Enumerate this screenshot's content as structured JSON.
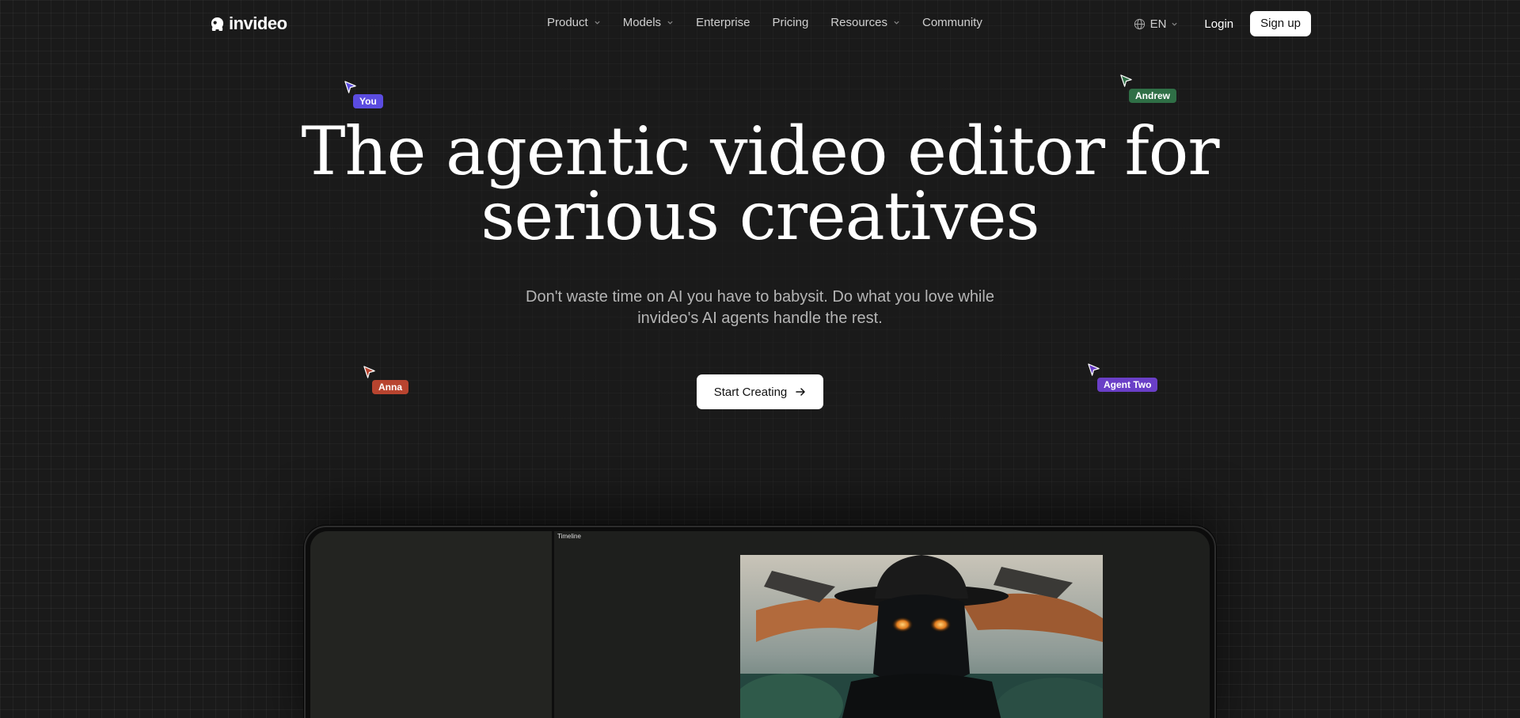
{
  "nav": {
    "logo_text": "invideo",
    "menu": [
      {
        "label": "Product",
        "dropdown": true
      },
      {
        "label": "Models",
        "dropdown": true
      },
      {
        "label": "Enterprise",
        "dropdown": false
      },
      {
        "label": "Pricing",
        "dropdown": false
      },
      {
        "label": "Resources",
        "dropdown": true
      },
      {
        "label": "Community",
        "dropdown": false
      }
    ],
    "language": "EN",
    "login": "Login",
    "signup": "Sign up"
  },
  "hero": {
    "headline_line1": "The agentic video editor for",
    "headline_line2": "serious creatives",
    "subheadline_line1": "Don't waste time on AI you have to babysit. Do what you love while",
    "subheadline_line2": "invideo's AI agents handle the rest.",
    "cta_label": "Start Creating"
  },
  "cursors": [
    {
      "name": "You",
      "color": "#5b4ce0"
    },
    {
      "name": "Andrew",
      "color": "#2f6f46"
    },
    {
      "name": "Anna",
      "color": "#b8442f"
    },
    {
      "name": "Agent Two",
      "color": "#6a3fc7"
    }
  ],
  "editor_preview": {
    "timeline_label": "Timeline"
  },
  "colors": {
    "background": "#1a1a1a",
    "text_muted": "#b5b5b5",
    "button_bg": "#ffffff"
  }
}
